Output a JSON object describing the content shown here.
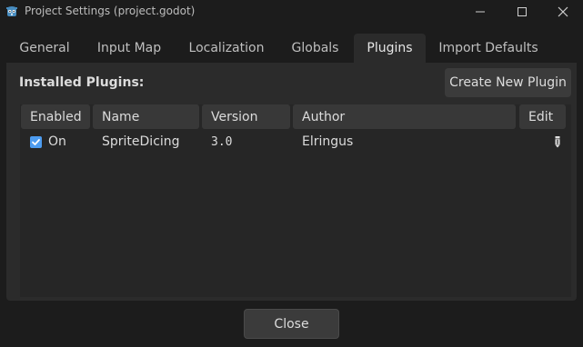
{
  "window": {
    "title": "Project Settings (project.godot)",
    "icon": "godot-icon"
  },
  "tabs": [
    {
      "label": "General",
      "active": false
    },
    {
      "label": "Input Map",
      "active": false
    },
    {
      "label": "Localization",
      "active": false
    },
    {
      "label": "Globals",
      "active": false
    },
    {
      "label": "Plugins",
      "active": true
    },
    {
      "label": "Import Defaults",
      "active": false
    }
  ],
  "plugins_panel": {
    "installed_label": "Installed Plugins:",
    "create_button_label": "Create New Plugin",
    "columns": [
      "Enabled",
      "Name",
      "Version",
      "Author",
      "Edit"
    ],
    "rows": [
      {
        "enabled": true,
        "enabled_label": "On",
        "name": "SpriteDicing",
        "version": "3.0",
        "author": "Elringus",
        "edit_icon": "pencil-icon"
      }
    ]
  },
  "footer": {
    "close_label": "Close"
  },
  "colors": {
    "background": "#1c1c1c",
    "panel": "#2b2b2b",
    "button": "#3b3b3b",
    "header_cell": "#383838",
    "checkbox_accent": "#4d9cf0",
    "text": "#dcdcdc"
  }
}
